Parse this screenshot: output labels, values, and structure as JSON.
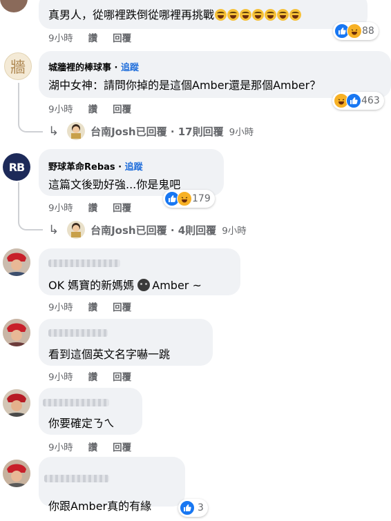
{
  "comments": [
    {
      "text": "真男人，從哪裡跌倒從哪裡再挑戰",
      "emoji_count": 7,
      "time": "9小時",
      "like_label": "讚",
      "reply_label": "回覆",
      "reaction_count": "88"
    },
    {
      "author": "城牆裡的棒球事",
      "follow_label": "追蹤",
      "avatar_text": "牆",
      "text": "湖中女神：請問你掉的是這個Amber還是那個Amber？",
      "time": "9小時",
      "like_label": "讚",
      "reply_label": "回覆",
      "reaction_count": "463",
      "reply_summary": {
        "name": "台南Josh",
        "text": "已回覆 · 17則回覆",
        "time": "9小時"
      }
    },
    {
      "author": "野球革命Rebas",
      "follow_label": "追蹤",
      "avatar_text": "RB",
      "text": "這篇文後勁好強...你是鬼吧",
      "time": "9小時",
      "like_label": "讚",
      "reply_label": "回覆",
      "reaction_count": "179",
      "reply_summary": {
        "name": "台南Josh",
        "text": "已回覆 · 4則回覆",
        "time": "9小時"
      }
    },
    {
      "text_before": "OK 媽寶的新媽媽 ",
      "text_after": "Amber ~",
      "time": "9小時",
      "like_label": "讚",
      "reply_label": "回覆"
    },
    {
      "text": "看到這個英文名字嚇一跳",
      "time": "9小時",
      "like_label": "讚",
      "reply_label": "回覆"
    },
    {
      "text": "你要確定ㄋㄟ",
      "time": "9小時",
      "like_label": "讚",
      "reply_label": "回覆"
    },
    {
      "text": "你跟Amber真的有緣",
      "reaction_count": "3"
    }
  ],
  "colors": {
    "bubble": "#f0f2f5",
    "like": "#1877f2",
    "haha": "#f7b125",
    "link": "#216fdb",
    "meta": "#65676b"
  },
  "icons": [
    "like-reaction-icon",
    "haha-reaction-icon",
    "reply-arrow-icon",
    "avatar-icon"
  ]
}
